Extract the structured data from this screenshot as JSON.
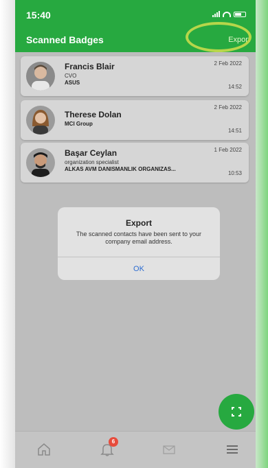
{
  "status_bar": {
    "time": "15:40"
  },
  "header": {
    "title": "Scanned Badges",
    "export_label": "Export"
  },
  "badges": [
    {
      "name": "Francis Blair",
      "role": "CVO",
      "company": "ASUS",
      "date": "2 Feb 2022",
      "time": "14:52"
    },
    {
      "name": "Therese Dolan",
      "role": "",
      "company": "MCI Group",
      "date": "2 Feb 2022",
      "time": "14:51"
    },
    {
      "name": "Başar Ceylan",
      "role": "organization specialist",
      "company": "ALKAS AVM DANISMANLIK ORGANIZAS...",
      "date": "1 Feb 2022",
      "time": "10:53"
    }
  ],
  "dialog": {
    "title": "Export",
    "message": "The scanned contacts have been sent to your company email address.",
    "ok_label": "OK"
  },
  "tabbar": {
    "notification_count": "6"
  },
  "icons": {
    "fab": "scan-icon",
    "tabs": [
      "home-icon",
      "bell-icon",
      "mail-icon",
      "menu-icon"
    ]
  },
  "colors": {
    "brand_green": "#27a940",
    "highlight_ring": "#b7d64a",
    "badge_red": "#e74c3c",
    "link_blue": "#2b6bd1"
  }
}
